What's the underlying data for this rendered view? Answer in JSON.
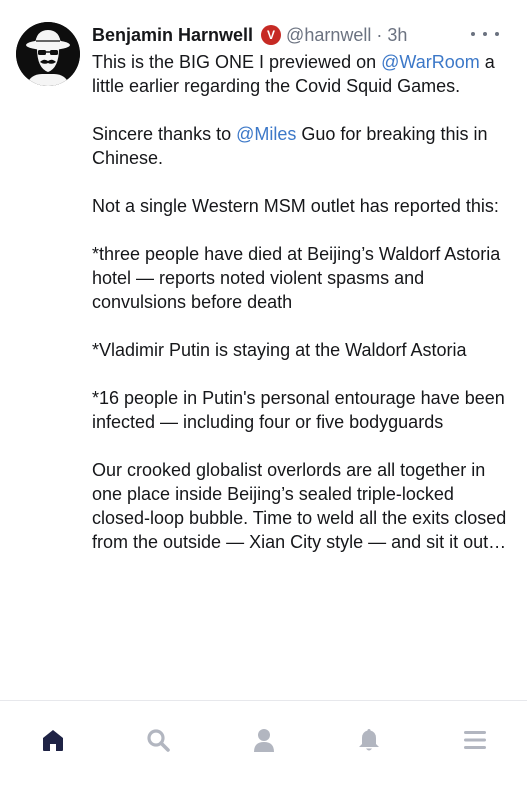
{
  "post": {
    "author": {
      "display_name": "Benjamin Harnwell",
      "handle": "@harnwell",
      "verified_badge": "V",
      "avatar_icon": "avatar-cartoon-hat-mustache"
    },
    "separator": "·",
    "timestamp": "3h",
    "more_icon": "more-dots-icon",
    "paragraphs": {
      "p1": {
        "before": "This is the BIG ONE I previewed on",
        "mention": "@WarRoom",
        "after": "a little earlier regarding the Covid Squid Games."
      },
      "p2": {
        "before": "Sincere thanks to",
        "mention": "@Miles",
        "after": "Guo for breaking this in Chinese."
      },
      "p3": "Not a single Western MSM outlet has reported this:",
      "p4": "*three people have died at Beijing’s Waldorf Astoria hotel — reports noted violent spasms and convulsions before death",
      "p5": "*Vladimir Putin is staying at the Waldorf Astoria",
      "p6": "*16 people in Putin's personal entourage have been infected — including four or five bodyguards",
      "p7": "Our crooked globalist overlords are all together in one place inside Beijing’s sealed triple-locked closed-loop bubble. Time to weld all the exits closed from the outside — Xian City style — and sit it out…"
    }
  },
  "bottom_nav": {
    "items": [
      {
        "icon": "home-icon",
        "active": true
      },
      {
        "icon": "search-icon",
        "active": false
      },
      {
        "icon": "profile-icon",
        "active": false
      },
      {
        "icon": "bell-icon",
        "active": false
      },
      {
        "icon": "menu-icon",
        "active": false
      }
    ]
  },
  "colors": {
    "text": "#16171a",
    "muted": "#6b7280",
    "link": "#3c78c8",
    "verified": "#c62a24",
    "nav_active": "#1f2345",
    "nav_inactive": "#b2b6c0"
  }
}
